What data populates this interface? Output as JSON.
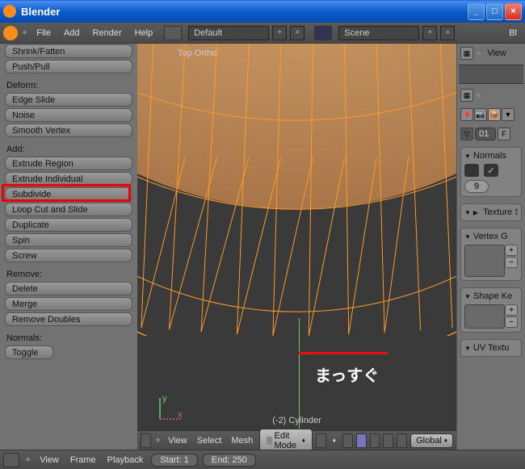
{
  "window": {
    "title": "Blender"
  },
  "menubar": {
    "items": [
      "File",
      "Add",
      "Render",
      "Help"
    ],
    "layout_dropdown": "Default",
    "scene_dropdown": "Scene",
    "right_label": "Bl"
  },
  "toolpanel": {
    "transform_items": [
      "Shrink/Fatten",
      "Push/Pull"
    ],
    "deform_header": "Deform:",
    "deform_items": [
      "Edge Slide",
      "Noise",
      "Smooth Vertex"
    ],
    "add_header": "Add:",
    "add_items": [
      "Extrude Region",
      "Extrude Individual",
      "Subdivide",
      "Loop Cut and Slide",
      "Duplicate",
      "Spin",
      "Screw"
    ],
    "remove_header": "Remove:",
    "remove_items": [
      "Delete",
      "Merge",
      "Remove Doubles"
    ],
    "normals_header": "Normals:",
    "normals_toggle": "Toggle"
  },
  "viewport": {
    "top_label": "Top Ortho",
    "object_label": "(-2) Cylinder",
    "annotation_text": "まっすぐ",
    "header": {
      "menus": [
        "View",
        "Select",
        "Mesh"
      ],
      "mode": "Edit Mode",
      "orientation": "Global"
    }
  },
  "right": {
    "topitems": [
      "View"
    ],
    "obj_field": "01",
    "obj_field_suffix": "F",
    "panels": {
      "normals": "Normals",
      "button_num": "9",
      "texture": "Texture S",
      "vertexg": "Vertex G",
      "shapek": "Shape Ke",
      "uvtex": "UV Textu"
    }
  },
  "timeline": {
    "menus": [
      "View",
      "Frame",
      "Playback"
    ],
    "start_label": "Start: 1",
    "end_label": "End: 250"
  }
}
